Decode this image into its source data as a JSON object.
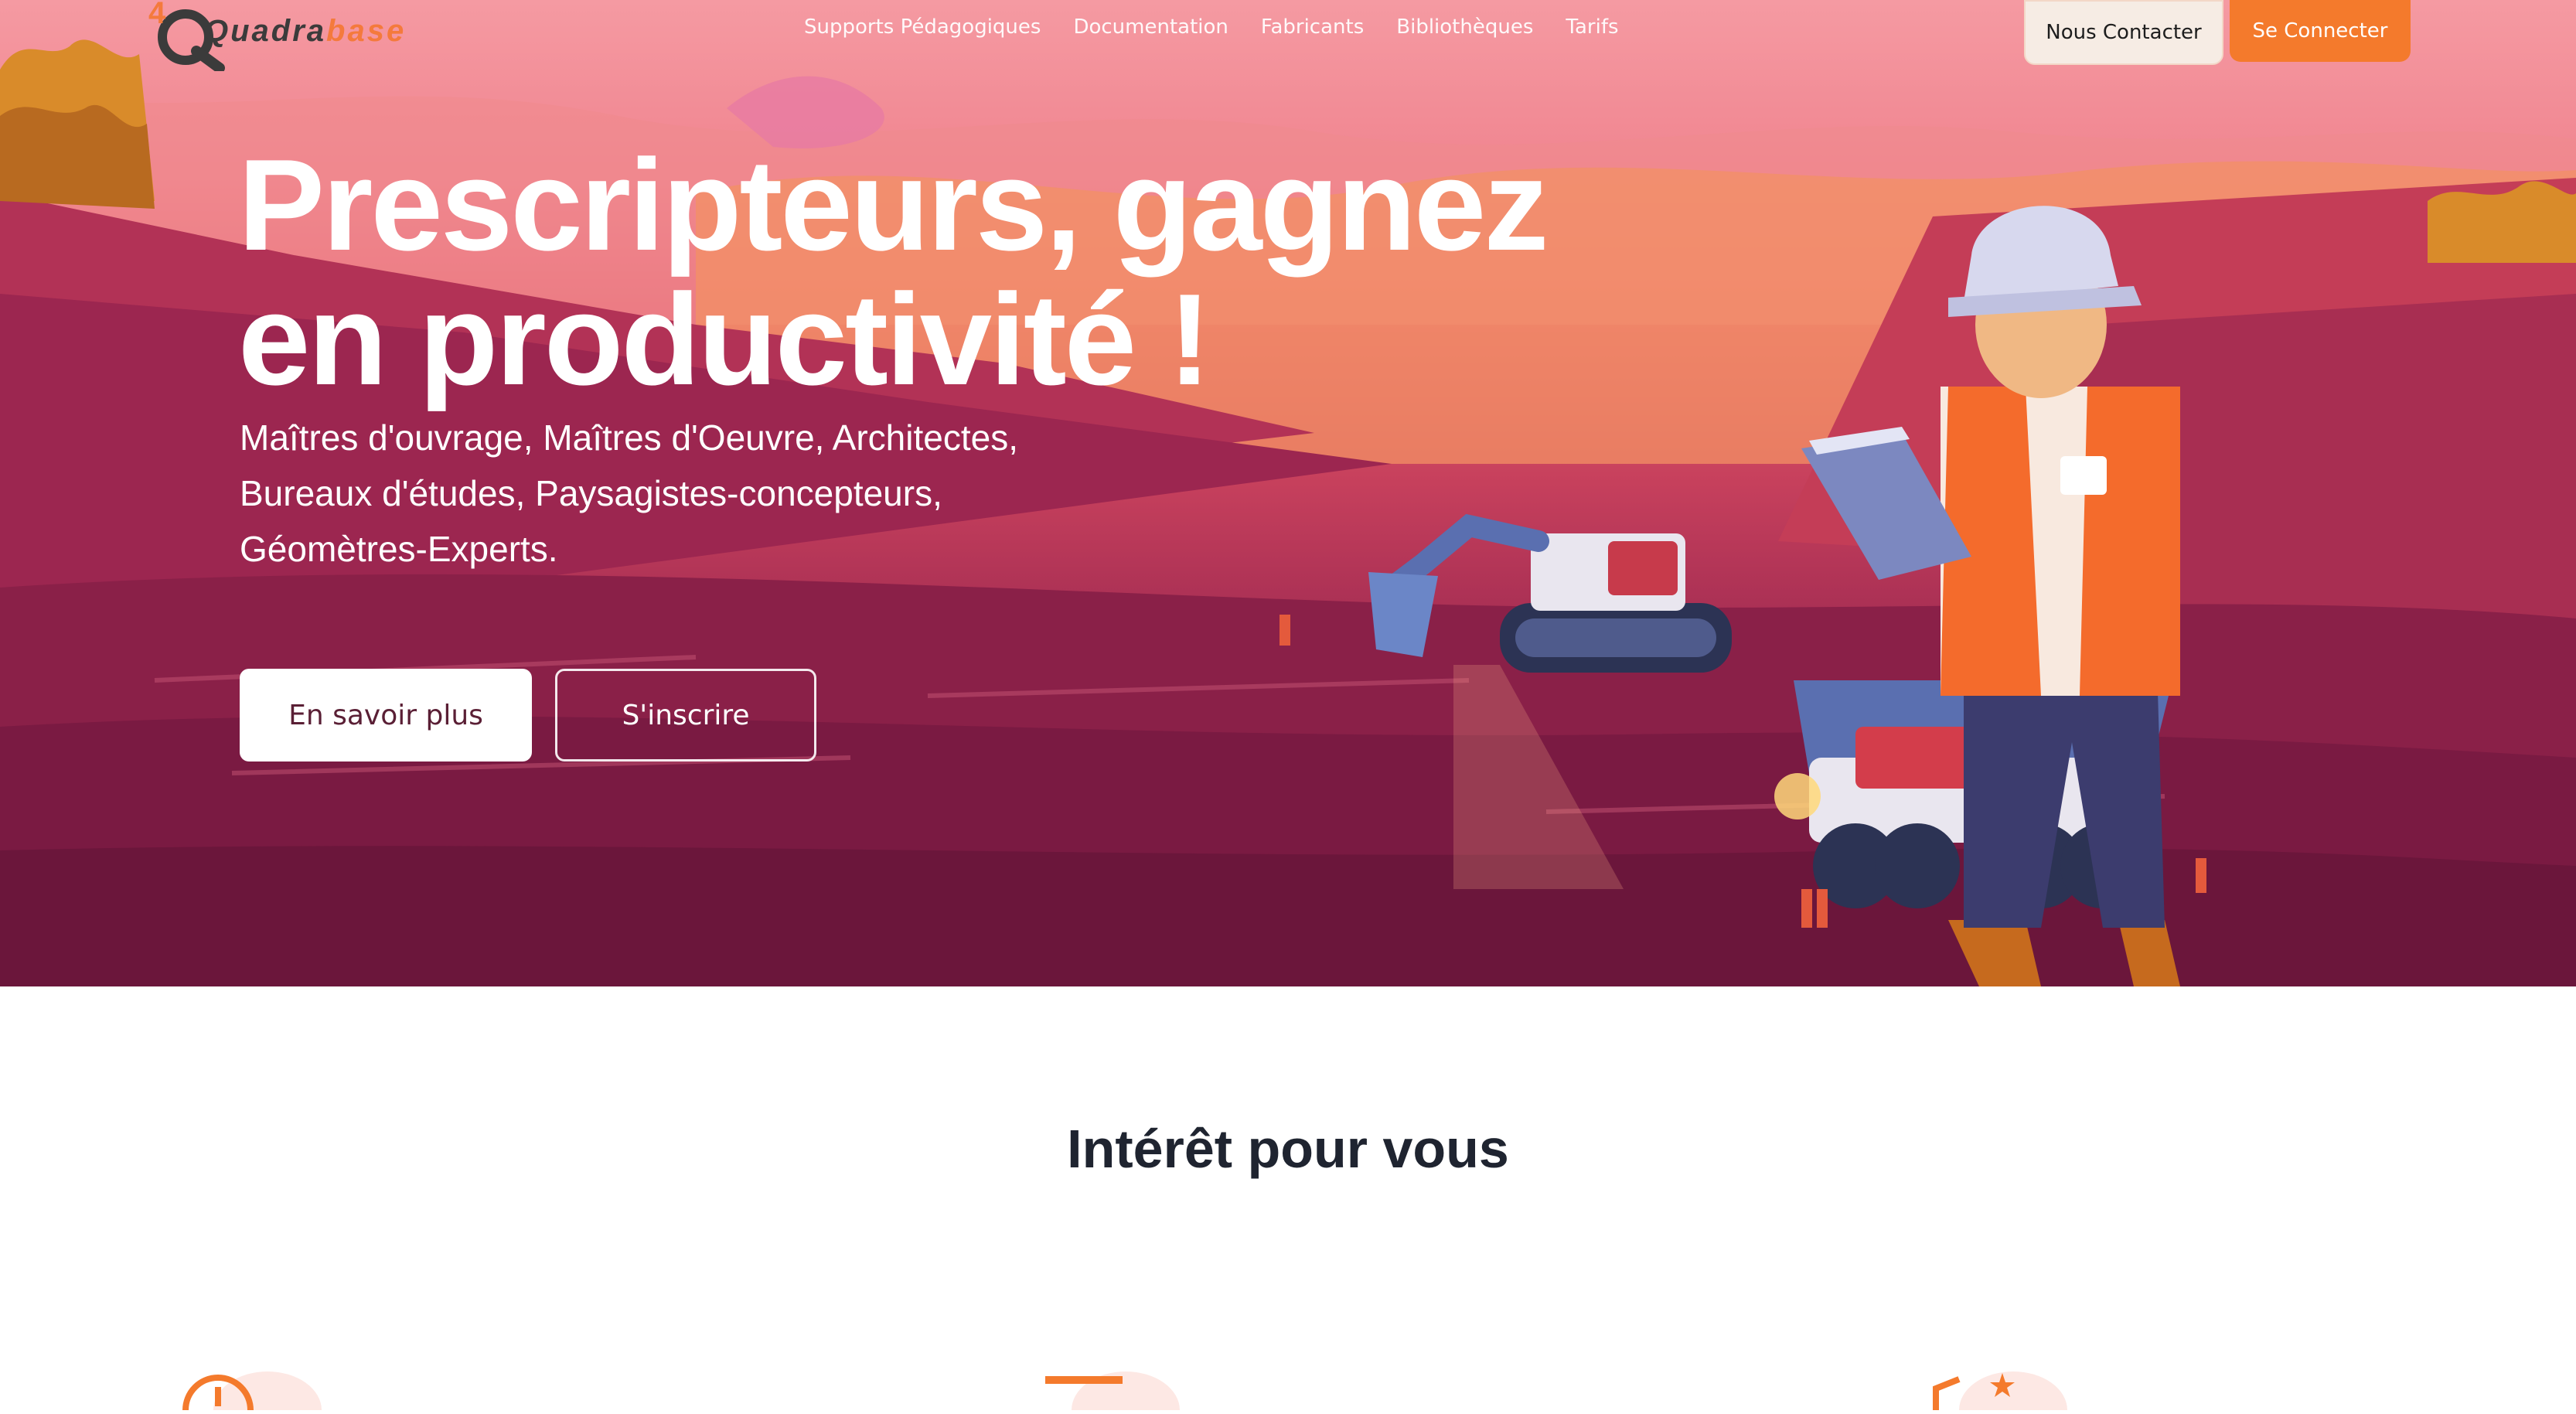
{
  "nav": {
    "logo_prefix": "4",
    "logo_main": "Quadra",
    "logo_accent": "base",
    "links": [
      {
        "label": "Supports Pédagogiques"
      },
      {
        "label": "Documentation"
      },
      {
        "label": "Fabricants"
      },
      {
        "label": "Bibliothèques"
      },
      {
        "label": "Tarifs"
      }
    ],
    "contact_label": "Nous Contacter",
    "login_label": "Se Connecter"
  },
  "hero": {
    "headline_line1": "Prescripteurs, gagnez",
    "headline_line2": "en productivité !",
    "sub_line1": "Maîtres d'ouvrage, Maîtres d'Oeuvre, Architectes,",
    "sub_line2": "Bureaux d'études, Paysagistes-concepteurs,",
    "sub_line3": "Géomètres-Experts.",
    "more_label": "En savoir plus",
    "signup_label": "S'inscrire"
  },
  "section": {
    "title": "Intérêt pour vous"
  },
  "colors": {
    "accent": "#f47a2c",
    "hero_top": "#f59aa2",
    "hero_bottom": "#8a2048",
    "text_dark": "#1f2430"
  }
}
